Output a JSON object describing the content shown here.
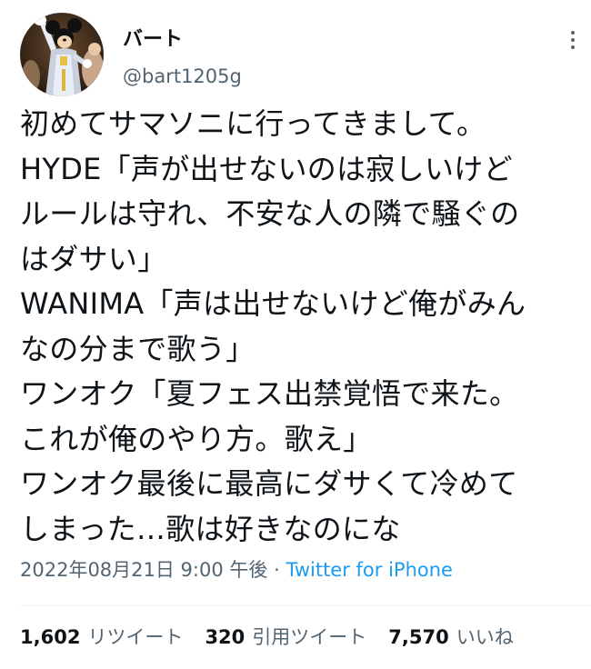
{
  "user": {
    "display_name": "バート",
    "handle": "@bart1205g",
    "avatar_icon": "mickey-avatar-icon"
  },
  "tweet": {
    "lines": [
      "初めてサマソニに行ってきまして。",
      "HYDE「声が出せないのは寂しいけど",
      "ルールは守れ、不安な人の隣で騒ぐの",
      "はダサい」",
      "WANIMA「声は出せないけど俺がみん",
      "なの分まで歌う」",
      "ワンオク「夏フェス出禁覚悟で来た。",
      "これが俺のやり方。歌え」",
      "ワンオク最後に最高にダサくて冷めて",
      "しまった…歌は好きなのにな"
    ]
  },
  "meta": {
    "timestamp": "2022年08月21日 9:00 午後",
    "separator": "·",
    "source": "Twitter for iPhone"
  },
  "stats": {
    "retweets_count": "1,602",
    "retweets_label": "リツイート",
    "quotes_count": "320",
    "quotes_label": "引用ツイート",
    "likes_count": "7,570",
    "likes_label": "いいね"
  },
  "colors": {
    "text": "#0f1419",
    "secondary": "#536471",
    "link": "#1d9bf0",
    "divider": "#eff3f4"
  }
}
